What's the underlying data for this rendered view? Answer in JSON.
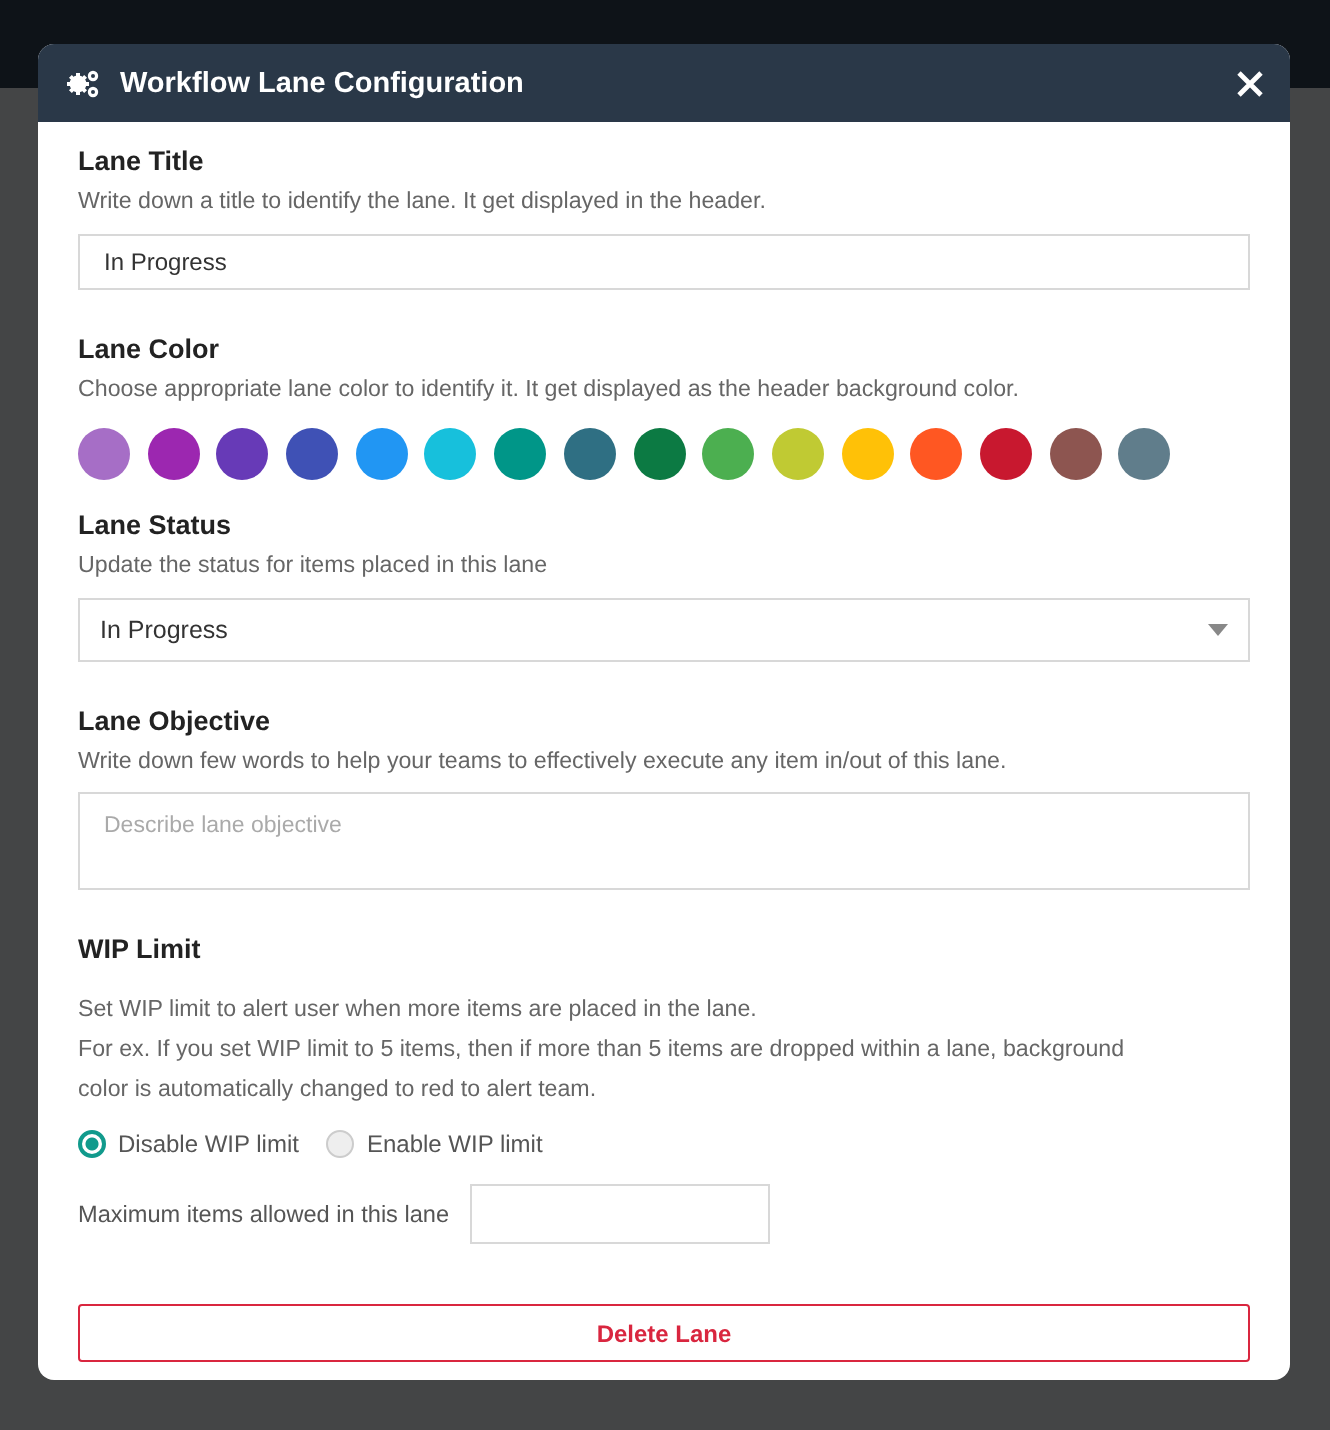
{
  "dialog": {
    "title": "Workflow Lane Configuration"
  },
  "lane_title": {
    "label": "Lane Title",
    "description": "Write down a title to identify the lane. It get displayed in the header.",
    "value": "In Progress"
  },
  "lane_color": {
    "label": "Lane Color",
    "description": "Choose appropriate lane color to identify it. It get displayed as the header background color.",
    "swatches": [
      {
        "color": "#a66ec6"
      },
      {
        "color": "#9c27b0"
      },
      {
        "color": "#673ab7"
      },
      {
        "color": "#3f51b5"
      },
      {
        "color": "#2196f3"
      },
      {
        "color": "#17c0dc"
      },
      {
        "color": "#009688"
      },
      {
        "color": "#2f6f83"
      },
      {
        "color": "#0c7a43"
      },
      {
        "color": "#4caf50"
      },
      {
        "color": "#c0ca33"
      },
      {
        "color": "#ffc107"
      },
      {
        "color": "#ff5722"
      },
      {
        "color": "#c8182f"
      },
      {
        "color": "#8d5550"
      },
      {
        "color": "#607d8b"
      }
    ]
  },
  "lane_status": {
    "label": "Lane Status",
    "description": "Update the status for items placed in this lane",
    "value": "In Progress"
  },
  "lane_objective": {
    "label": "Lane Objective",
    "description": "Write down few words to help your teams to effectively execute any item in/out of this lane.",
    "placeholder": "Describe lane objective"
  },
  "wip_limit": {
    "label": "WIP Limit",
    "description_lines": [
      "Set WIP limit to alert user when more items are placed in the lane.",
      "For ex. If you set WIP limit to 5 items, then if more than 5 items are dropped within a lane, background",
      "color is automatically changed to red to alert team."
    ],
    "options": [
      {
        "label": "Disable WIP limit",
        "selected": true
      },
      {
        "label": "Enable WIP limit",
        "selected": false
      }
    ],
    "max_items_label": "Maximum items allowed in this lane"
  },
  "delete_button": "Delete Lane"
}
